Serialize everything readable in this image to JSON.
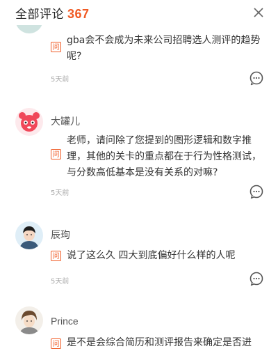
{
  "header": {
    "title": "全部评论",
    "count": "367"
  },
  "comments": [
    {
      "author": "",
      "tag": "问",
      "text": "gba会不会成为未来公司招聘选人测评的趋势呢?",
      "time": "5天前"
    },
    {
      "author": "大罐儿",
      "tag": "问",
      "text": "老师，请问除了您提到的图形逻辑和数字推理，其他的关卡的重点都在于行为性格测试，与分数高低基本是没有关系的对嘛?",
      "time": "5天前"
    },
    {
      "author": "辰珣",
      "tag": "问",
      "text": "说了这么久 四大到底偏好什么样的人呢",
      "time": "5天前"
    },
    {
      "author": "Prince",
      "tag": "问",
      "text": "是不是会综合简历和测评报告来确定是否进",
      "time": ""
    }
  ],
  "colors": {
    "accent": "#f05a24",
    "muted": "#aaaaaa"
  }
}
